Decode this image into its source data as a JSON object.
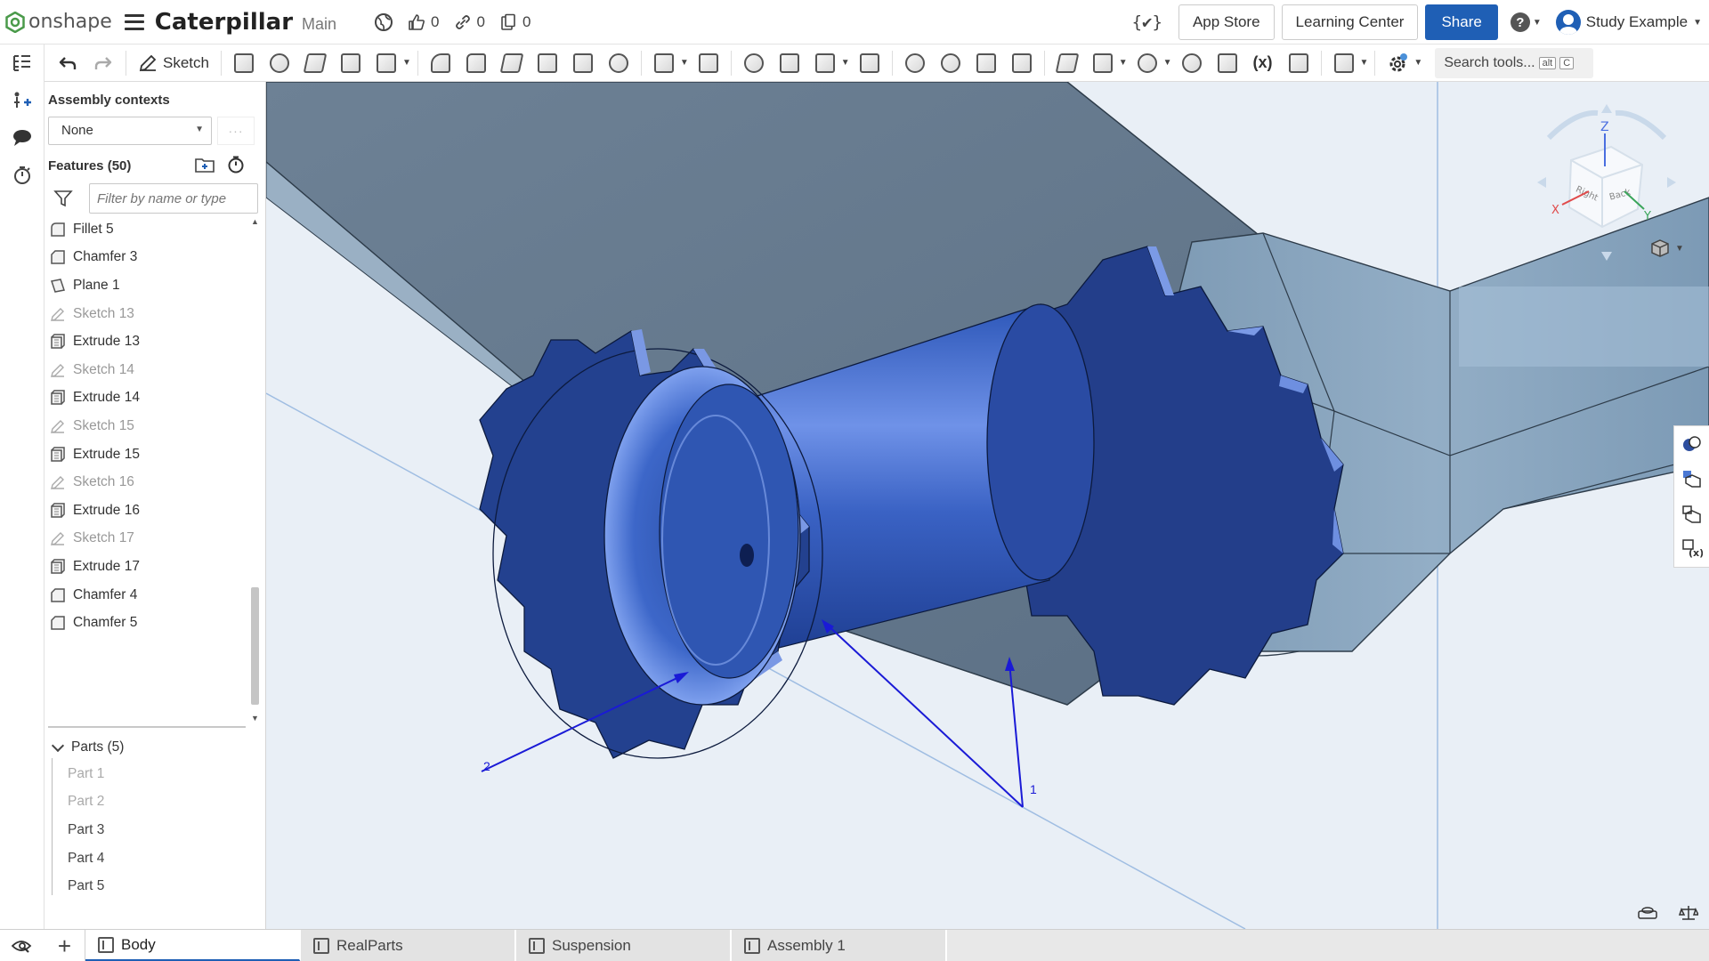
{
  "header": {
    "logo_text": "onshape",
    "document_title": "Caterpillar",
    "branch": "Main",
    "likes": "0",
    "links": "0",
    "copies": "0",
    "variable_symbol": "{✔}",
    "app_store": "App Store",
    "learning_center": "Learning Center",
    "share": "Share",
    "user_name": "Study Example"
  },
  "toolbar": {
    "sketch_label": "Sketch",
    "variable_label": "(x)",
    "search_label": "Search tools...",
    "search_key1": "alt",
    "search_key2": "C"
  },
  "panel": {
    "assembly_contexts_title": "Assembly contexts",
    "context_value": "None",
    "features_title": "Features (50)",
    "filter_placeholder": "Filter by name or type",
    "features": [
      {
        "label": "Fillet 5",
        "type": "fillet"
      },
      {
        "label": "Chamfer 3",
        "type": "chamfer"
      },
      {
        "label": "Plane 1",
        "type": "plane"
      },
      {
        "label": "Sketch 13",
        "type": "sketch"
      },
      {
        "label": "Extrude 13",
        "type": "extrude"
      },
      {
        "label": "Sketch 14",
        "type": "sketch"
      },
      {
        "label": "Extrude 14",
        "type": "extrude"
      },
      {
        "label": "Sketch 15",
        "type": "sketch"
      },
      {
        "label": "Extrude 15",
        "type": "extrude"
      },
      {
        "label": "Sketch 16",
        "type": "sketch"
      },
      {
        "label": "Extrude 16",
        "type": "extrude"
      },
      {
        "label": "Sketch 17",
        "type": "sketch"
      },
      {
        "label": "Extrude 17",
        "type": "extrude"
      },
      {
        "label": "Chamfer 4",
        "type": "chamfer"
      },
      {
        "label": "Chamfer 5",
        "type": "chamfer"
      }
    ],
    "parts_title": "Parts (5)",
    "parts": [
      {
        "label": "Part 1",
        "dim": true
      },
      {
        "label": "Part 2",
        "dim": true
      },
      {
        "label": "Part 3",
        "dim": false
      },
      {
        "label": "Part 4",
        "dim": false
      },
      {
        "label": "Part 5",
        "dim": false
      }
    ]
  },
  "viewport": {
    "annotation_1": "1",
    "annotation_2": "2",
    "view_cube": {
      "top": "Z",
      "right": "Right",
      "back": "Back",
      "axis_x": "X",
      "axis_y": "Y"
    }
  },
  "tabs": [
    {
      "label": "Body",
      "active": true
    },
    {
      "label": "RealParts",
      "active": false
    },
    {
      "label": "Suspension",
      "active": false
    },
    {
      "label": "Assembly 1",
      "active": false
    }
  ],
  "colors": {
    "accent": "#1f5fb5",
    "part_blue": "#23478f",
    "frame_blue": "#6f8ea8",
    "annotation": "#1a1ad6"
  }
}
